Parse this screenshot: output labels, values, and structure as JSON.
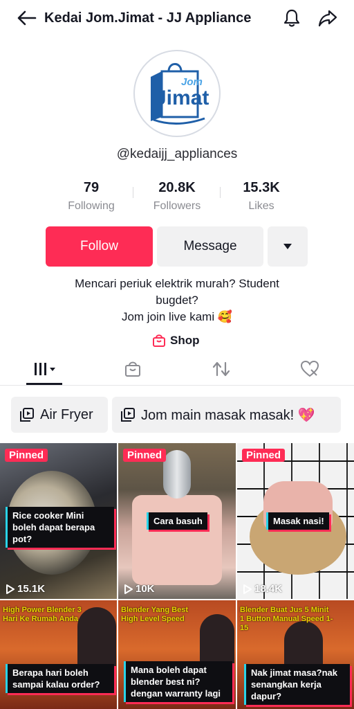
{
  "header": {
    "title": "Kedai Jom.Jimat - JJ Appliance"
  },
  "profile": {
    "logo_top": "Jom",
    "logo_main": "Jimat",
    "handle": "@kedaijj_appliances",
    "stats": [
      {
        "value": "79",
        "label": "Following"
      },
      {
        "value": "20.8K",
        "label": "Followers"
      },
      {
        "value": "15.3K",
        "label": "Likes"
      }
    ],
    "follow_label": "Follow",
    "message_label": "Message",
    "bio_line1": "Mencari periuk elektrik murah? Student",
    "bio_line2": "bugdet?",
    "bio_line3": "Jom join live kami 🥰",
    "shop_label": "Shop"
  },
  "playlists": [
    {
      "label": "Air Fryer"
    },
    {
      "label": "Jom main masak masak! 💖"
    }
  ],
  "videos": [
    {
      "pinned": "Pinned",
      "caption": "Rice cooker Mini boleh dapat berapa pot?",
      "views": "15.1K"
    },
    {
      "pinned": "Pinned",
      "caption": "Cara basuh",
      "views": "10K"
    },
    {
      "pinned": "Pinned",
      "caption": "Masak nasi!",
      "views": "18.4K"
    },
    {
      "overlay": "High Power Blender 3 Hari Ke Rumah Anda",
      "caption": "Berapa hari boleh sampai kalau order?"
    },
    {
      "overlay": "Blender Yang Best High Level Speed",
      "caption": "Mana boleh dapat blender best ni?dengan warranty lagi"
    },
    {
      "overlay": "Blender Buat Jus 5 Minit 1 Button Manual Speed 1-15",
      "caption": "Nak jimat masa?nak senangkan kerja dapur?"
    }
  ],
  "colors": {
    "accent": "#fe2c55",
    "caption_border": "#29d3e8",
    "logo_blue": "#1f5fa8"
  }
}
